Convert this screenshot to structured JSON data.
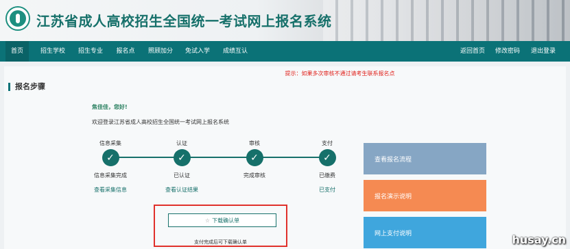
{
  "header": {
    "title": "江苏省成人高校招生全国统一考试网上报名系统"
  },
  "nav": {
    "left": [
      "首页",
      "招生学校",
      "招生专业",
      "报名点",
      "照顾加分",
      "免试入学",
      "成绩互认"
    ],
    "right": [
      "返回首页",
      "修改密码",
      "退出登录"
    ]
  },
  "tip": "提示：如果多次审核不通过请考生联系报名点",
  "section_title": "报名步骤",
  "greeting": "焦佳佳，您好!",
  "welcome": "欢迎登录江苏省成人高校招生全国统一考试网上报名系统",
  "steps": [
    {
      "label": "信息采集",
      "status": "信息采集完成",
      "link": "查看采集信息"
    },
    {
      "label": "认证",
      "status": "已认证",
      "link": "查看认证结果"
    },
    {
      "label": "审核",
      "status": "完成审核",
      "link": ""
    },
    {
      "label": "支付",
      "status": "已缴费",
      "link": "已支付"
    }
  ],
  "confirm": {
    "button": "下载确认单",
    "note": "支付完成后可下载确认单"
  },
  "cards": [
    "查看报名流程",
    "报名演示说明",
    "网上支付说明"
  ],
  "watermark": "husay.cn",
  "colors": {
    "primary": "#0b7277",
    "alert": "#e0221c",
    "card_blue": "#86a6c4",
    "card_orange": "#f58a52",
    "card_sky": "#3fa6dd"
  },
  "icons": {
    "check": "check-icon",
    "star": "star-icon"
  }
}
